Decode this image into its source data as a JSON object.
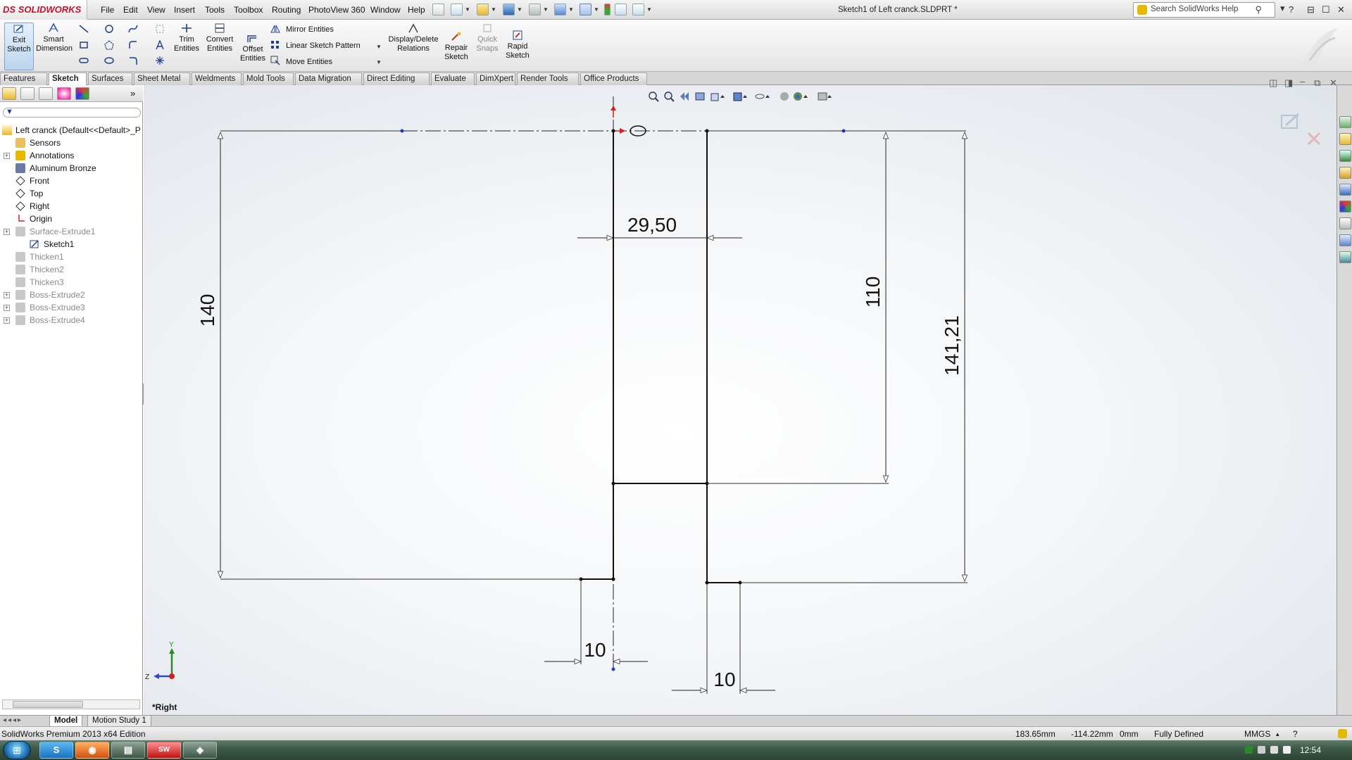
{
  "app": {
    "logo_text": "SOLIDWORKS",
    "logo_prefix": "DS",
    "document_title": "Sketch1 of Left cranck.SLDPRT *",
    "search_placeholder": "Search SolidWorks Help",
    "help_glyph": "?",
    "window_glyphs": [
      "⊟",
      "☐",
      "✕"
    ]
  },
  "menu": [
    "File",
    "Edit",
    "View",
    "Insert",
    "Tools",
    "Toolbox",
    "Routing",
    "PhotoView 360",
    "Window",
    "Help"
  ],
  "command_manager": {
    "exit_sketch": "Exit Sketch",
    "smart_dimension": "Smart Dimension",
    "trim_entities": "Trim Entities",
    "convert_entities": "Convert Entities",
    "offset_entities": "Offset Entities",
    "mirror_entities": "Mirror Entities",
    "linear_sketch_pattern": "Linear Sketch Pattern",
    "move_entities": "Move Entities",
    "display_delete_relations": "Display/Delete Relations",
    "repair_sketch": "Repair Sketch",
    "quick_snaps": "Quick Snaps",
    "rapid_sketch": "Rapid Sketch"
  },
  "tabs": [
    "Features",
    "Sketch",
    "Surfaces",
    "Sheet Metal",
    "Weldments",
    "Mold Tools",
    "Data Migration",
    "Direct Editing",
    "Evaluate",
    "DimXpert",
    "Render Tools",
    "Office Products"
  ],
  "active_tab": "Sketch",
  "feature_tree": {
    "root": "Left cranck  (Default<<Default>_P",
    "items": [
      {
        "label": "Sensors",
        "icon": "sensors-icon",
        "suppressed": false,
        "expandable": false
      },
      {
        "label": "Annotations",
        "icon": "annotations-icon",
        "suppressed": false,
        "expandable": true
      },
      {
        "label": "Aluminum Bronze",
        "icon": "material-icon",
        "suppressed": false,
        "expandable": false
      },
      {
        "label": "Front",
        "icon": "plane-icon",
        "suppressed": false,
        "expandable": false
      },
      {
        "label": "Top",
        "icon": "plane-icon",
        "suppressed": false,
        "expandable": false
      },
      {
        "label": "Right",
        "icon": "plane-icon",
        "suppressed": false,
        "expandable": false
      },
      {
        "label": "Origin",
        "icon": "origin-icon",
        "suppressed": false,
        "expandable": false
      },
      {
        "label": "Surface-Extrude1",
        "icon": "surface-extrude-icon",
        "suppressed": true,
        "expandable": true
      },
      {
        "label": "Sketch1",
        "icon": "sketch-icon",
        "suppressed": false,
        "expandable": false,
        "child": true
      },
      {
        "label": "Thicken1",
        "icon": "thicken-icon",
        "suppressed": true,
        "expandable": false
      },
      {
        "label": "Thicken2",
        "icon": "thicken-icon",
        "suppressed": true,
        "expandable": false
      },
      {
        "label": "Thicken3",
        "icon": "thicken-icon",
        "suppressed": true,
        "expandable": false
      },
      {
        "label": "Boss-Extrude2",
        "icon": "boss-extrude-icon",
        "suppressed": true,
        "expandable": true
      },
      {
        "label": "Boss-Extrude3",
        "icon": "boss-extrude-icon",
        "suppressed": true,
        "expandable": true
      },
      {
        "label": "Boss-Extrude4",
        "icon": "boss-extrude-icon",
        "suppressed": true,
        "expandable": true
      }
    ]
  },
  "viewport": {
    "view_name": "*Right",
    "triad": {
      "y": "Y",
      "z": "Z"
    },
    "dimensions": {
      "height_left": "140",
      "width_top": "29,50",
      "height_right_inner": "110",
      "height_right_outer": "141,21",
      "bottom_left": "10",
      "bottom_right": "10"
    }
  },
  "model_tabs": [
    "Model",
    "Motion Study 1"
  ],
  "status": {
    "edition": "SolidWorks Premium 2013 x64 Edition",
    "x": "183.65mm",
    "y": "-114.22mm",
    "z": "0mm",
    "state": "Fully Defined",
    "units": "MMGS"
  },
  "taskbar": {
    "clock": "12:54",
    "start_glyph": "⊞",
    "apps": [
      "S",
      "◉",
      "▤",
      "SW",
      "◈"
    ]
  },
  "colors": {
    "accent_red": "#c8102e",
    "selection_blue": "#7fa3cc",
    "sketch_line": "#111111",
    "origin_red": "#d22020",
    "point_blue": "#1a3cc8"
  }
}
